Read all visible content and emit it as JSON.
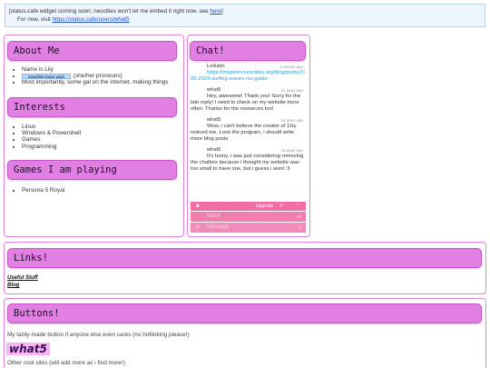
{
  "notice": {
    "line1_text": "[status.cafe widget coming soon; neocities won't let me embed it right now. see ",
    "line1_link": "here",
    "line1_end": "]",
    "line2_text": "For now, visit ",
    "line2_link": "https://status.cafe/users/what5"
  },
  "about": {
    "title": "About Me",
    "name": "Name is Lily",
    "pronoun_badge": "transfem trans yeah",
    "pronouns": "(she/her pronouns)",
    "important": "Most importantly, some gal on the internet, making things"
  },
  "interests": {
    "title": "Interests",
    "items": [
      "Linux",
      "Windows & Powershell",
      "Games",
      "Programming"
    ]
  },
  "games": {
    "title": "Games I am playing",
    "items": [
      "Persona 5 Royal"
    ]
  },
  "chat": {
    "title": "Chat!",
    "messages": [
      {
        "name": "Leilukin",
        "time": "2 weeks ago",
        "text": "https://maptren.neocities.org/blog/posts/19-05-2024-surfing-waves-rss-guide"
      },
      {
        "name": "what5",
        "time": "21 days ago",
        "text": "Hey, awesome! Thank you! Sorry for the late reply! I need to check on my website more often. Thanks for the resources too!"
      },
      {
        "name": "what5",
        "time": "15 days ago",
        "text": "Wow, i can't believe the creator of 11ty noticed me. Love the program, i should write more blog posts"
      },
      {
        "name": "what5",
        "time": "15 days ago",
        "text": "It's funny, i was just considering removing the chatbox because i thought my website was too small to have one, but i guess i wont :3"
      }
    ],
    "bar_person_icon": "person-icon",
    "upgrade": "Upgrade",
    "name_placeholder": "name",
    "name_count": "40",
    "message_placeholder": "message",
    "message_count": "0"
  },
  "links": {
    "title": "Links!",
    "items": [
      "Useful Stuff",
      "Blog"
    ]
  },
  "buttons": {
    "title": "Buttons!",
    "desc": "My lazily-made button if anyone else even cares (no hotlinking please!)",
    "button_label": "what5",
    "other": "Other cool sites (will add more as i find more!)"
  },
  "colors": {
    "header_bg": "#e27fe2",
    "card_border": "#e083d9",
    "chat_accent": "#f06ea5"
  }
}
